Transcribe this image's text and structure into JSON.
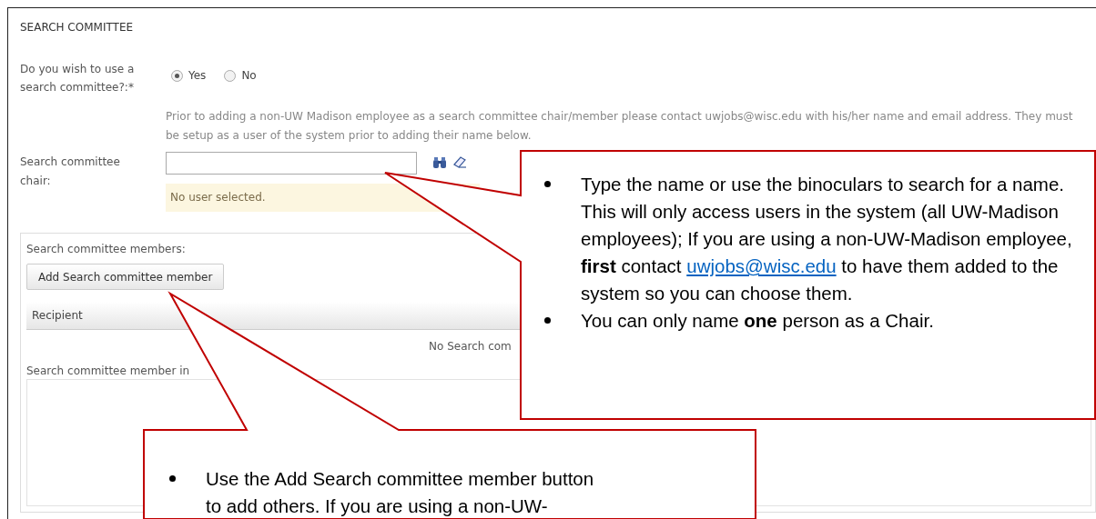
{
  "section_title": "SEARCH COMMITTEE",
  "use_committee": {
    "label": "Do you wish to use a search committee?:*",
    "options": [
      {
        "label": "Yes",
        "selected": true
      },
      {
        "label": "No",
        "selected": false
      }
    ]
  },
  "help_text": "Prior to adding a non-UW Madison employee as a search committee chair/member please contact uwjobs@wisc.edu with his/her name and email address. They must be setup as a user of the system prior to adding their name below.",
  "chair": {
    "label": "Search committee chair:",
    "status": "No user selected."
  },
  "members": {
    "label": "Search committee members:",
    "add_button": "Add Search committee member",
    "table": {
      "columns": [
        "Recipient"
      ],
      "empty_message": "No Search com"
    },
    "info_label": "Search committee member in"
  },
  "callouts": [
    {
      "bullets": [
        {
          "segments": [
            {
              "kind": "text",
              "text": "Type the name or use the binoculars to search for a name. This will only access users in the system (all UW-Madison employees); If you are using a non-UW-Madison employee, **first** contact "
            },
            {
              "kind": "link",
              "text": "uwjobs@wisc.edu"
            },
            {
              "kind": "text",
              "text": " to have them added to the system so you can choose them."
            }
          ]
        },
        {
          "segments": [
            {
              "kind": "text",
              "text": "You can only name **one** person as a Chair."
            }
          ]
        }
      ]
    },
    {
      "bullets": [
        {
          "segments": [
            {
              "kind": "text",
              "text": "Use the Add Search committee member button"
            },
            {
              "kind": "break"
            },
            {
              "kind": "text",
              "text": "to add others. If you are using a non-UW-"
            }
          ]
        }
      ]
    }
  ]
}
